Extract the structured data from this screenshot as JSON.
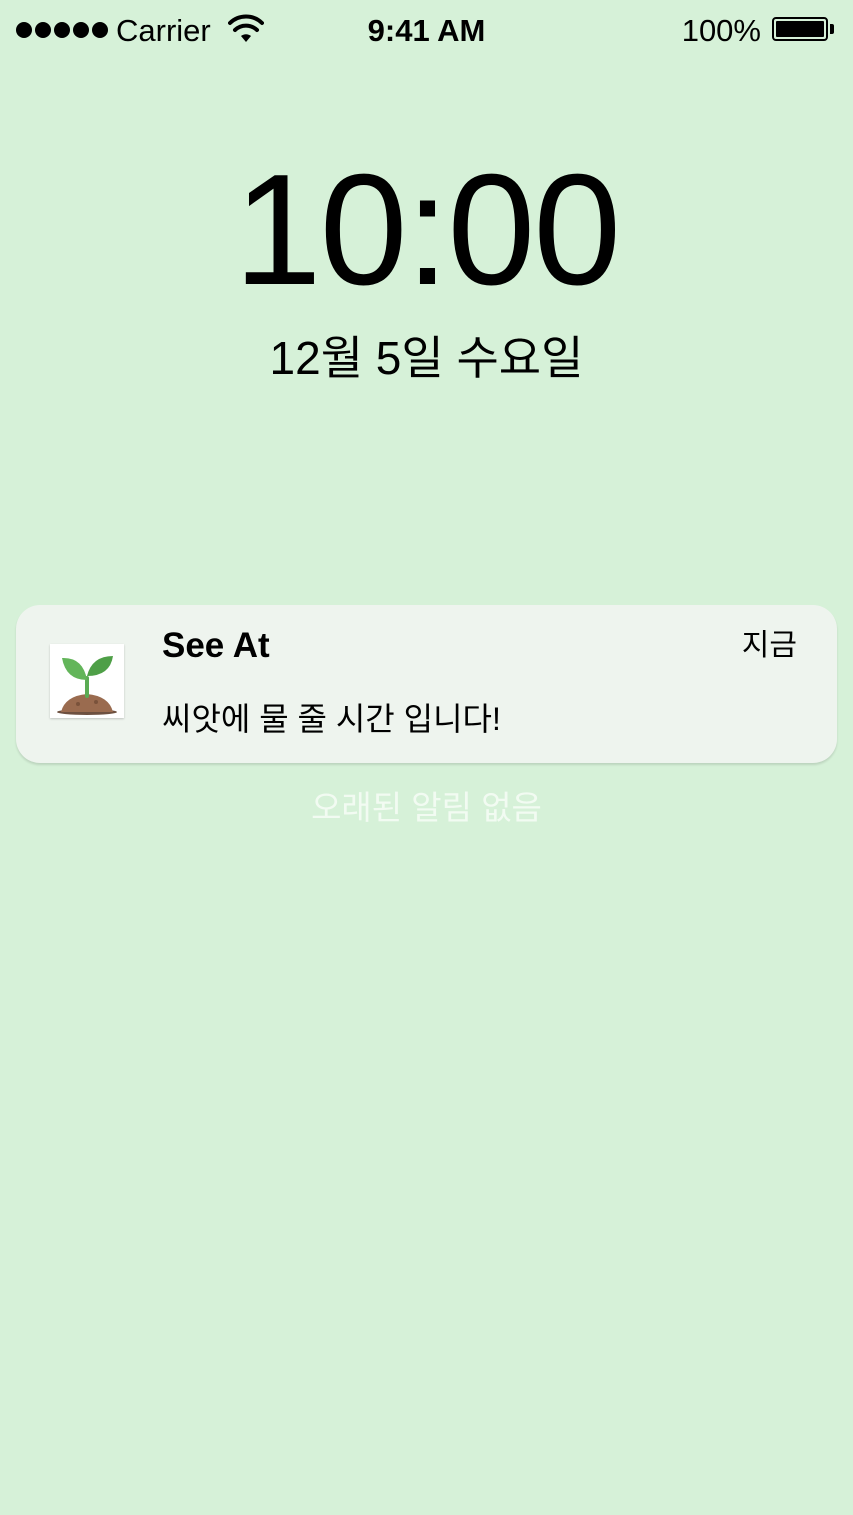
{
  "status_bar": {
    "carrier": "Carrier",
    "time": "9:41 AM",
    "battery_percent": "100%",
    "signal_icon": "signal-dots-icon",
    "wifi_icon": "wifi-icon",
    "battery_icon": "battery-icon",
    "battery_level": 1.0
  },
  "lock_screen": {
    "clock": "10:00",
    "date": "12월 5일 수요일"
  },
  "notification": {
    "app_name": "See At",
    "time": "지금",
    "message": "씨앗에 물 줄 시간 입니다!",
    "icon": "sprout-icon"
  },
  "no_older_notifications": "오래된 알림 없음",
  "colors": {
    "background": "#d6f1d8",
    "notification_background": "#eef4ee",
    "muted_text": "#f2fbf2"
  }
}
